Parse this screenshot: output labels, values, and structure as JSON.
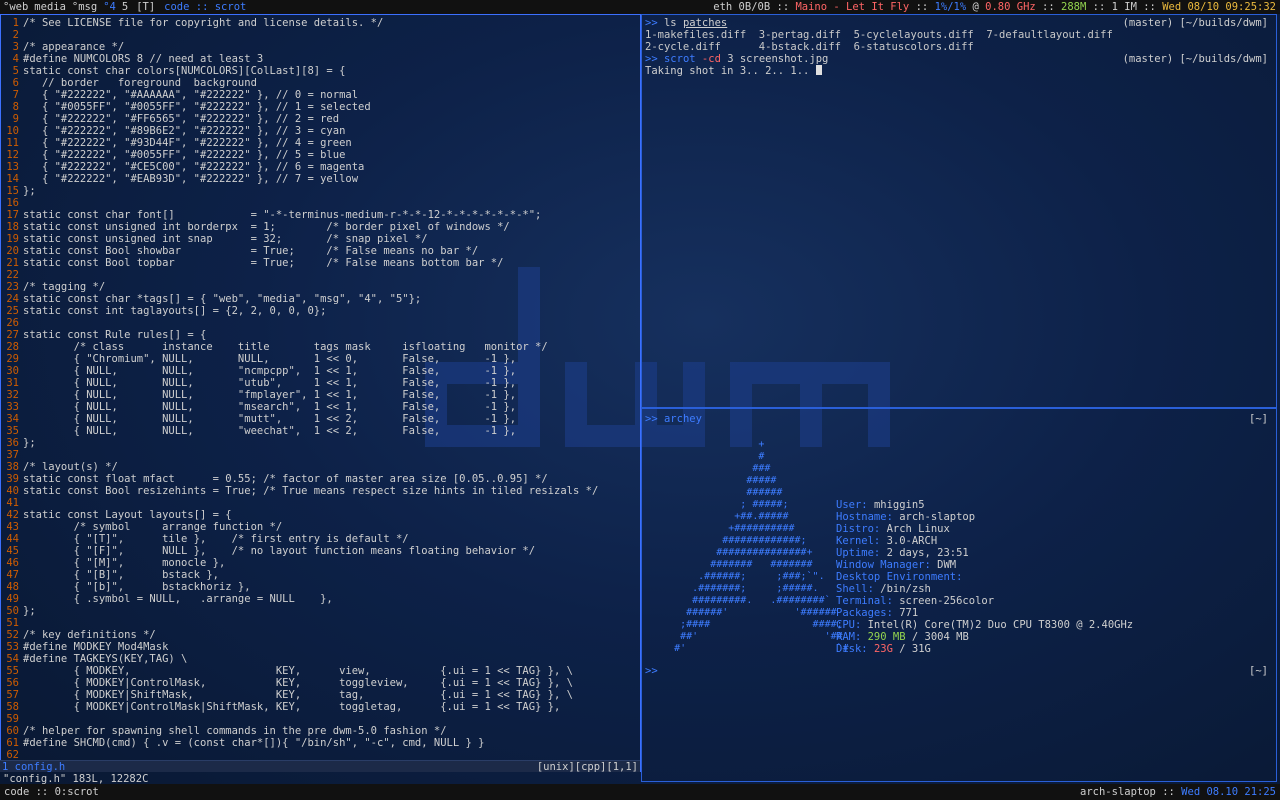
{
  "topbar": {
    "tags": [
      {
        "label": "°web",
        "selected": false
      },
      {
        "label": "media",
        "selected": false
      },
      {
        "label": "°msg",
        "selected": false
      },
      {
        "label": "°4",
        "selected": true
      },
      {
        "label": "5",
        "selected": false
      }
    ],
    "layout": "[T]",
    "window_title": "code :: scrot",
    "status": {
      "net": "eth 0B/0B",
      "sep1": " :: ",
      "music": "Maino - Let It Fly",
      "sep2": " :: ",
      "cpu": "1%/1%",
      "at": " @ ",
      "freq": "0.80 GHz",
      "sep3": " :: ",
      "mem": "288M",
      "sep4": " :: ",
      "im": "1 IM",
      "sep5": " :: ",
      "date": "Wed 08/10 09:25:32"
    }
  },
  "watermark": {
    "text": "dwm"
  },
  "vim": {
    "lines": [
      {
        "n": "1",
        "t": "/* See LICENSE file for copyright and license details. */",
        "c": "cm"
      },
      {
        "n": "2",
        "t": "",
        "c": "kw"
      },
      {
        "n": "3",
        "t": "/* appearance */",
        "c": "cm"
      },
      {
        "n": "4",
        "t": "#define NUMCOLORS 8 // need at least 3",
        "c": "pp"
      },
      {
        "n": "5",
        "t": "static const char colors[NUMCOLORS][ColLast][8] = {",
        "c": "kw"
      },
      {
        "n": "6",
        "t": "   // border   foreground  background",
        "c": "cm"
      },
      {
        "n": "7",
        "t": "   { \"#222222\", \"#AAAAAA\", \"#222222\" }, // 0 = normal",
        "c": "st"
      },
      {
        "n": "8",
        "t": "   { \"#0055FF\", \"#0055FF\", \"#222222\" }, // 1 = selected",
        "c": "st"
      },
      {
        "n": "9",
        "t": "   { \"#222222\", \"#FF6565\", \"#222222\" }, // 2 = red",
        "c": "st"
      },
      {
        "n": "10",
        "t": "   { \"#222222\", \"#89B6E2\", \"#222222\" }, // 3 = cyan",
        "c": "st"
      },
      {
        "n": "11",
        "t": "   { \"#222222\", \"#93D44F\", \"#222222\" }, // 4 = green",
        "c": "st"
      },
      {
        "n": "12",
        "t": "   { \"#222222\", \"#0055FF\", \"#222222\" }, // 5 = blue",
        "c": "st"
      },
      {
        "n": "13",
        "t": "   { \"#222222\", \"#CE5C00\", \"#222222\" }, // 6 = magenta",
        "c": "st"
      },
      {
        "n": "14",
        "t": "   { \"#222222\", \"#EAB93D\", \"#222222\" }, // 7 = yellow",
        "c": "st"
      },
      {
        "n": "15",
        "t": "};",
        "c": "kw"
      },
      {
        "n": "16",
        "t": "",
        "c": "kw"
      },
      {
        "n": "17",
        "t": "static const char font[]            = \"-*-terminus-medium-r-*-*-12-*-*-*-*-*-*-*\";",
        "c": "kw"
      },
      {
        "n": "18",
        "t": "static const unsigned int borderpx  = 1;        /* border pixel of windows */",
        "c": "kw"
      },
      {
        "n": "19",
        "t": "static const unsigned int snap      = 32;       /* snap pixel */",
        "c": "kw"
      },
      {
        "n": "20",
        "t": "static const Bool showbar           = True;     /* False means no bar */",
        "c": "kw"
      },
      {
        "n": "21",
        "t": "static const Bool topbar            = True;     /* False means bottom bar */",
        "c": "kw"
      },
      {
        "n": "22",
        "t": "",
        "c": "kw"
      },
      {
        "n": "23",
        "t": "/* tagging */",
        "c": "cm"
      },
      {
        "n": "24",
        "t": "static const char *tags[] = { \"web\", \"media\", \"msg\", \"4\", \"5\"};",
        "c": "kw"
      },
      {
        "n": "25",
        "t": "static const int taglayouts[] = {2, 2, 0, 0, 0};",
        "c": "kw"
      },
      {
        "n": "26",
        "t": "",
        "c": "kw"
      },
      {
        "n": "27",
        "t": "static const Rule rules[] = {",
        "c": "kw"
      },
      {
        "n": "28",
        "t": "        /* class      instance    title       tags mask     isfloating   monitor */",
        "c": "cm"
      },
      {
        "n": "29",
        "t": "        { \"Chromium\", NULL,       NULL,       1 << 0,       False,       -1 },",
        "c": "kw"
      },
      {
        "n": "30",
        "t": "        { NULL,       NULL,       \"ncmpcpp\",  1 << 1,       False,       -1 },",
        "c": "kw"
      },
      {
        "n": "31",
        "t": "        { NULL,       NULL,       \"utub\",     1 << 1,       False,       -1 },",
        "c": "kw"
      },
      {
        "n": "32",
        "t": "        { NULL,       NULL,       \"fmplayer\", 1 << 1,       False,       -1 },",
        "c": "kw"
      },
      {
        "n": "33",
        "t": "        { NULL,       NULL,       \"msearch\",  1 << 1,       False,       -1 },",
        "c": "kw"
      },
      {
        "n": "34",
        "t": "        { NULL,       NULL,       \"mutt\",     1 << 2,       False,       -1 },",
        "c": "kw"
      },
      {
        "n": "35",
        "t": "        { NULL,       NULL,       \"weechat\",  1 << 2,       False,       -1 },",
        "c": "kw"
      },
      {
        "n": "36",
        "t": "};",
        "c": "kw"
      },
      {
        "n": "37",
        "t": "",
        "c": "kw"
      },
      {
        "n": "38",
        "t": "/* layout(s) */",
        "c": "cm"
      },
      {
        "n": "39",
        "t": "static const float mfact      = 0.55; /* factor of master area size [0.05..0.95] */",
        "c": "kw"
      },
      {
        "n": "40",
        "t": "static const Bool resizehints = True; /* True means respect size hints in tiled resizals */",
        "c": "kw"
      },
      {
        "n": "41",
        "t": "",
        "c": "kw"
      },
      {
        "n": "42",
        "t": "static const Layout layouts[] = {",
        "c": "kw"
      },
      {
        "n": "43",
        "t": "        /* symbol     arrange function */",
        "c": "cm"
      },
      {
        "n": "44",
        "t": "        { \"[T]\",      tile },    /* first entry is default */",
        "c": "kw"
      },
      {
        "n": "45",
        "t": "        { \"[F]\",      NULL },    /* no layout function means floating behavior */",
        "c": "kw"
      },
      {
        "n": "46",
        "t": "        { \"[M]\",      monocle },",
        "c": "kw"
      },
      {
        "n": "47",
        "t": "        { \"[B]\",      bstack },",
        "c": "kw"
      },
      {
        "n": "48",
        "t": "        { \"[b]\",      bstackhoriz },",
        "c": "kw"
      },
      {
        "n": "49",
        "t": "        { .symbol = NULL,   .arrange = NULL    },",
        "c": "kw"
      },
      {
        "n": "50",
        "t": "};",
        "c": "kw"
      },
      {
        "n": "51",
        "t": "",
        "c": "kw"
      },
      {
        "n": "52",
        "t": "/* key definitions */",
        "c": "cm"
      },
      {
        "n": "53",
        "t": "#define MODKEY Mod4Mask",
        "c": "pp"
      },
      {
        "n": "54",
        "t": "#define TAGKEYS(KEY,TAG) \\",
        "c": "pp"
      },
      {
        "n": "55",
        "t": "        { MODKEY,                       KEY,      view,           {.ui = 1 << TAG} }, \\",
        "c": "pp"
      },
      {
        "n": "56",
        "t": "        { MODKEY|ControlMask,           KEY,      toggleview,     {.ui = 1 << TAG} }, \\",
        "c": "pp"
      },
      {
        "n": "57",
        "t": "        { MODKEY|ShiftMask,             KEY,      tag,            {.ui = 1 << TAG} }, \\",
        "c": "pp"
      },
      {
        "n": "58",
        "t": "        { MODKEY|ControlMask|ShiftMask, KEY,      toggletag,      {.ui = 1 << TAG} },",
        "c": "pp"
      },
      {
        "n": "59",
        "t": "",
        "c": "kw"
      },
      {
        "n": "60",
        "t": "/* helper for spawning shell commands in the pre dwm-5.0 fashion */",
        "c": "cm"
      },
      {
        "n": "61",
        "t": "#define SHCMD(cmd) { .v = (const char*[]){ \"/bin/sh\", \"-c\", cmd, NULL } }",
        "c": "pp"
      },
      {
        "n": "62",
        "t": "",
        "c": "kw"
      }
    ],
    "status_left": "1 config.h",
    "status_right": "[unix][cpp][1,1]",
    "message": "\"config.h\" 183L, 12282C"
  },
  "term1": {
    "prompt": ">>",
    "cmd1": "ls",
    "cmd1_arg": "patches",
    "right1": "(master) [~/builds/dwm]",
    "ls_row1": "1-makefiles.diff  3-pertag.diff  5-cyclelayouts.diff  7-defaultlayout.diff",
    "ls_row2": "2-cycle.diff      4-bstack.diff  6-statuscolors.diff",
    "cmd2": "scrot",
    "cmd2_flag": "-cd",
    "cmd2_rest": "3 screenshot.jpg",
    "right2": "(master) [~/builds/dwm]",
    "output": "Taking shot in 3.. 2.. 1.. "
  },
  "term2": {
    "prompt": ">>",
    "cmd": "archey",
    "right": "[~]",
    "logo": [
      "                  +",
      "                  #",
      "                 ###",
      "                #####",
      "                ######",
      "               ; #####;",
      "              +##.#####",
      "             +##########",
      "            #############;",
      "           ###############+",
      "          #######   #######",
      "        .######;     ;###;`\".",
      "       .#######;     ;#####.",
      "       #########.   .########`",
      "      ######'           '######",
      "     ;####                 ####;",
      "     ##'                     '##",
      "    #'                         `#"
    ],
    "info": [
      {
        "k": "User: ",
        "v": "mhiggin5"
      },
      {
        "k": "Hostname: ",
        "v": "arch-slaptop"
      },
      {
        "k": "Distro: ",
        "v": "Arch Linux"
      },
      {
        "k": "Kernel: ",
        "v": "3.0-ARCH"
      },
      {
        "k": "Uptime: ",
        "v": "2 days, 23:51"
      },
      {
        "k": "Window Manager: ",
        "v": "DWM"
      },
      {
        "k": "Desktop Environment: ",
        "v": ""
      },
      {
        "k": "Shell: ",
        "v": "/bin/zsh"
      },
      {
        "k": "Terminal: ",
        "v": "screen-256color"
      },
      {
        "k": "Packages: ",
        "v": "771"
      },
      {
        "k": "CPU: ",
        "v": "Intel(R) Core(TM)2 Duo CPU T8300 @ 2.40GHz"
      }
    ],
    "ram_label": "RAM: ",
    "ram_used": "290 MB",
    "ram_total": " / 3004 MB",
    "disk_label": "Disk: ",
    "disk_used": "23G",
    "disk_total": " / 31G",
    "prompt2": ">>",
    "right2": "[~]"
  },
  "botbar": {
    "left": "code :: 0:scrot",
    "host": "arch-slaptop",
    "sep": " :: ",
    "date": "Wed 08.10 21:25"
  },
  "colors": {
    "accent_blue": "#0055FF",
    "red": "#FF6565",
    "green": "#93D44F",
    "yellow": "#EAB93D",
    "orange": "#CE5C00",
    "background": "#222222"
  }
}
